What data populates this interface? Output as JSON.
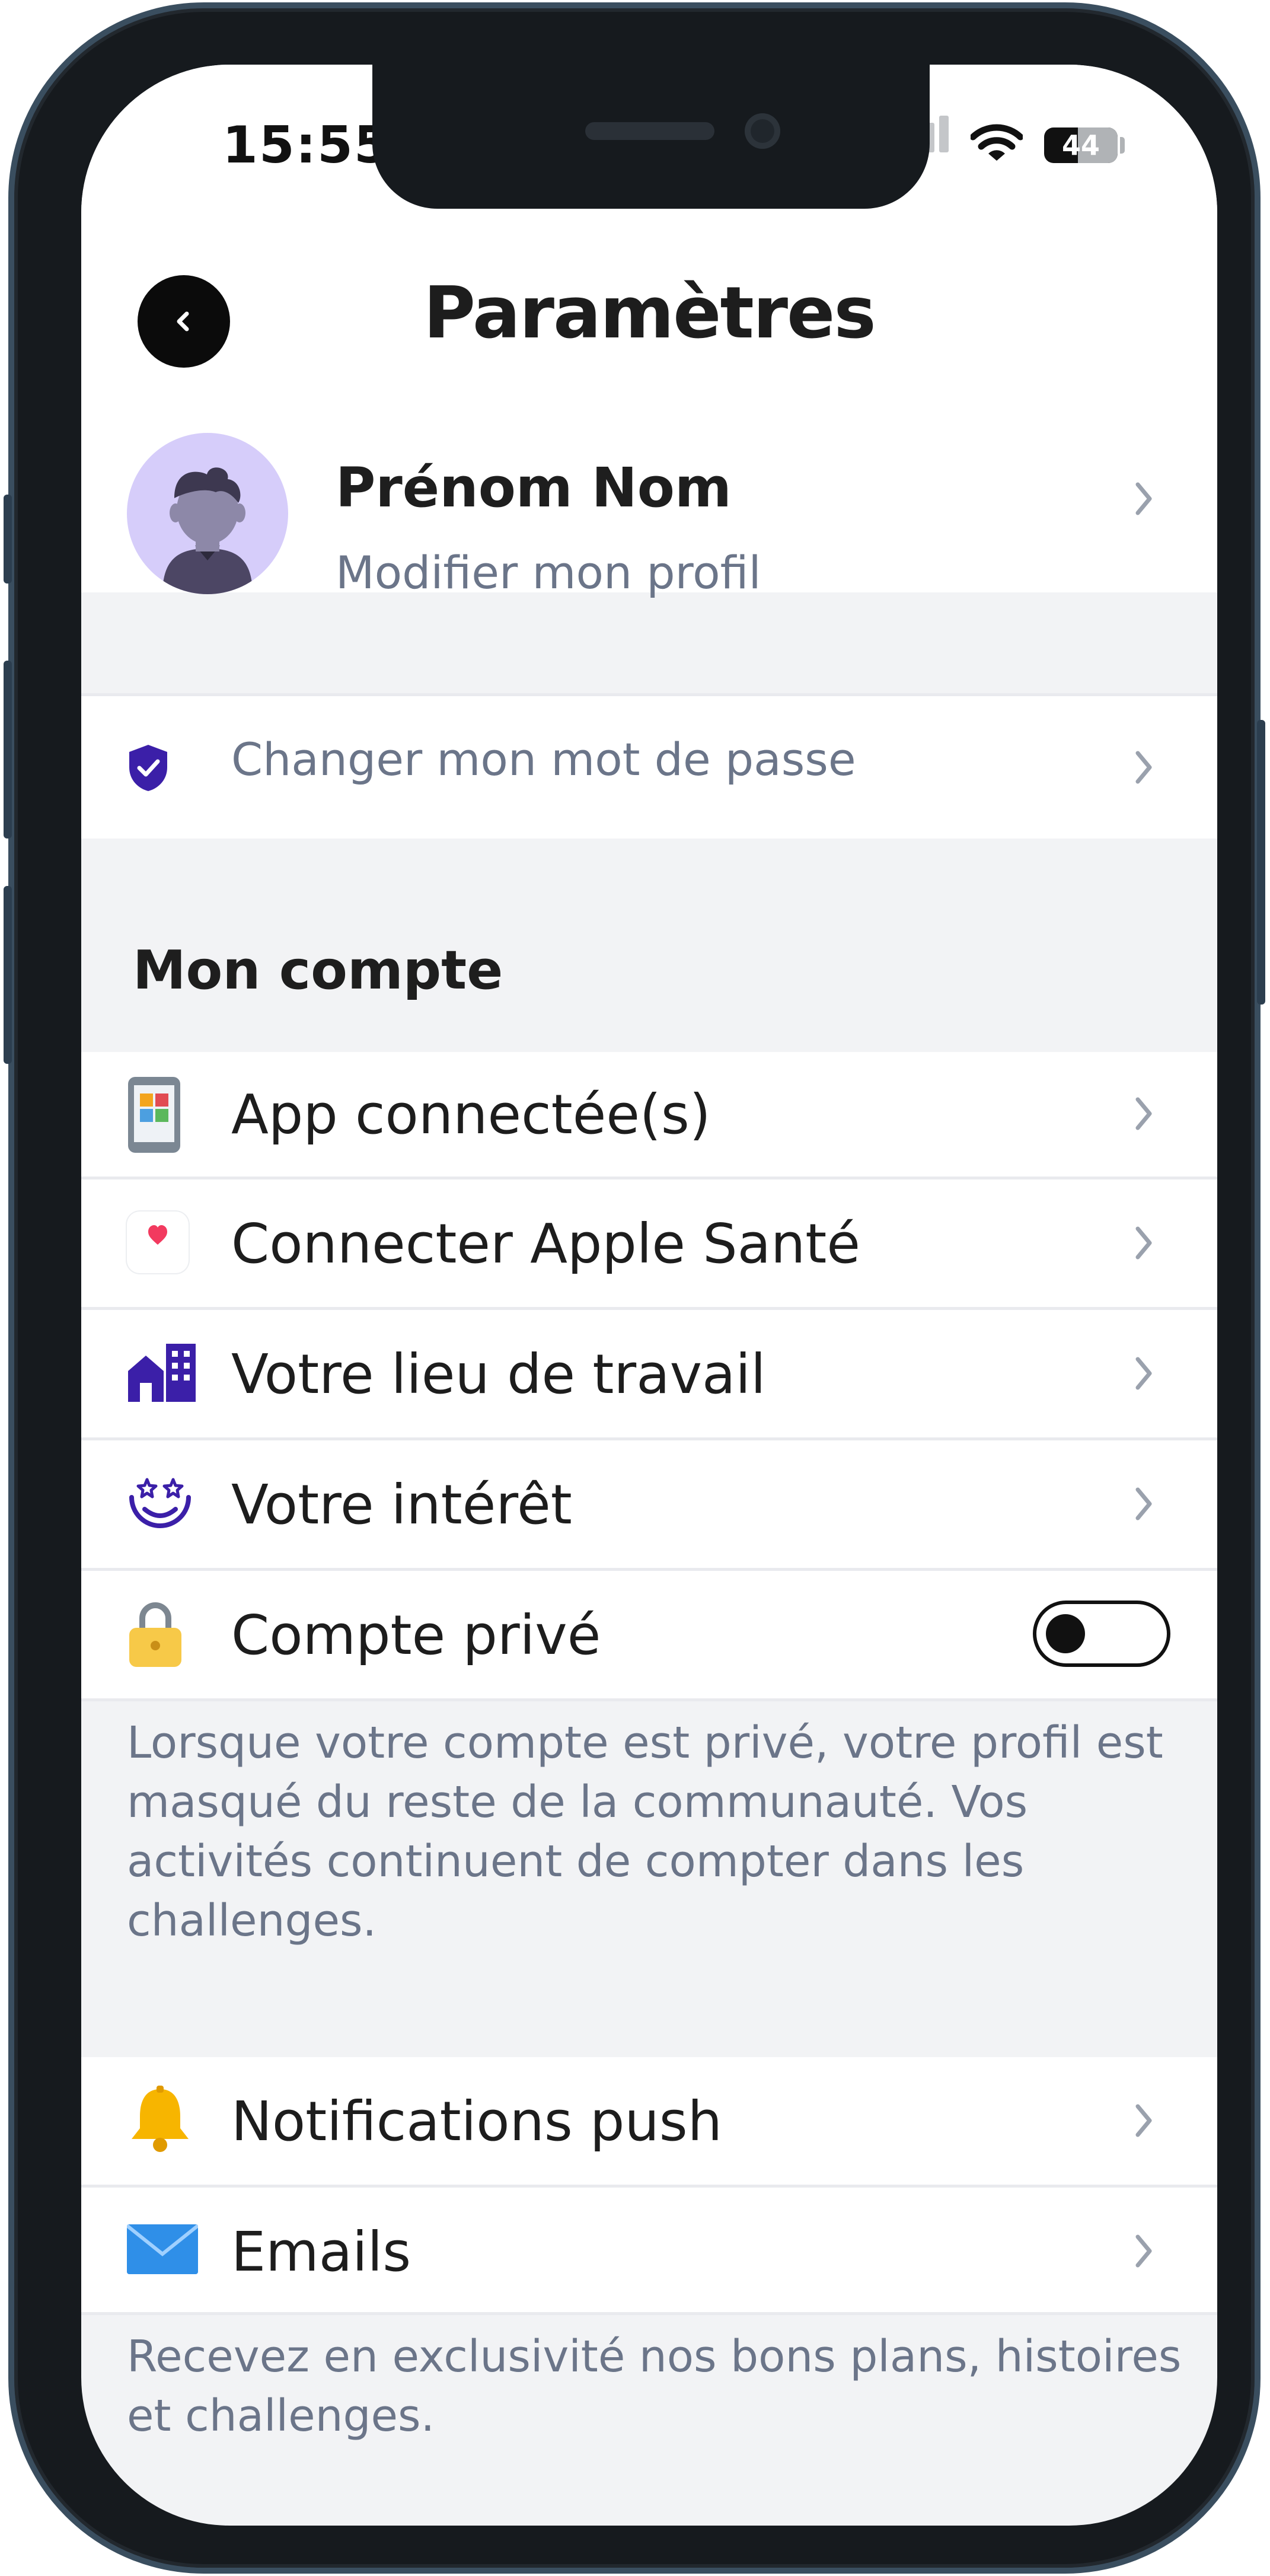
{
  "status_bar": {
    "time": "15:55",
    "battery": "44"
  },
  "header": {
    "title": "Paramètres"
  },
  "profile": {
    "name": "Prénom Nom",
    "subtitle": "Modifier mon profil"
  },
  "password": {
    "label": "Changer mon mot de passe"
  },
  "account_section": {
    "title": "Mon compte",
    "items": [
      {
        "label": "App connectée(s)",
        "icon": "connected-app-icon"
      },
      {
        "label": "Connecter Apple Santé",
        "icon": "apple-health-icon"
      },
      {
        "label": "Votre lieu de travail",
        "icon": "workplace-icon"
      },
      {
        "label": "Votre intérêt",
        "icon": "interest-icon"
      },
      {
        "label": "Compte privé",
        "icon": "lock-icon",
        "toggle": false
      }
    ],
    "private_note": "Lorsque votre compte est privé, votre profil est masqué du reste de la communauté. Vos activités continuent de compter dans les challenges."
  },
  "notifications_section": {
    "items": [
      {
        "label": "Notifications push",
        "icon": "bell-icon"
      },
      {
        "label": "Emails",
        "icon": "envelope-icon"
      }
    ],
    "note": "Recevez en exclusivité nos bons plans, histoires et challenges."
  },
  "colors": {
    "accent": "#3b1fa8",
    "muted_text": "#6b7589",
    "background": "#f2f3f5"
  }
}
